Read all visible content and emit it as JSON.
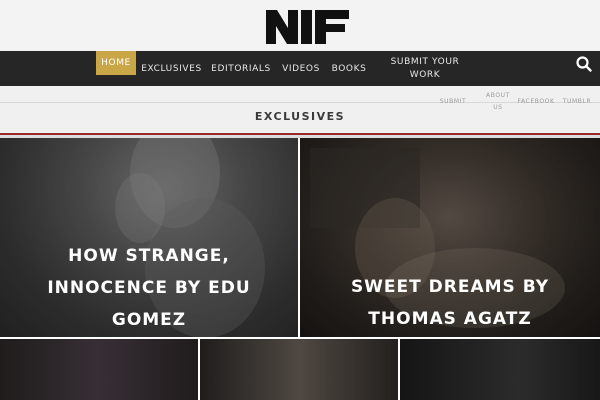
{
  "header": {
    "logo_text": "NIF"
  },
  "nav": {
    "items": [
      {
        "label": "Home"
      },
      {
        "label": "Exclusives"
      },
      {
        "label": "Editorials"
      },
      {
        "label": "Videos"
      },
      {
        "label": "Books"
      },
      {
        "label_line1": "Submit your",
        "label_line2": "Work"
      }
    ],
    "search_icon": "search-icon"
  },
  "subbar": {
    "links": [
      {
        "label": "Submit"
      },
      {
        "label_line1": "About",
        "label_line2": "Us"
      },
      {
        "label": "Facebook"
      },
      {
        "label": "Tumblr"
      }
    ]
  },
  "section": {
    "title": "EXCLUSIVES"
  },
  "colors": {
    "accent": "#c9a646",
    "nav_bg": "#262626",
    "rule": "#9c2a2a"
  },
  "cards": [
    {
      "title": "How strange, innocence by Edu Gomez"
    },
    {
      "title": "Sweet dreams by Thomas Agatz"
    },
    {
      "title": ""
    },
    {
      "title": ""
    },
    {
      "title": ""
    }
  ]
}
